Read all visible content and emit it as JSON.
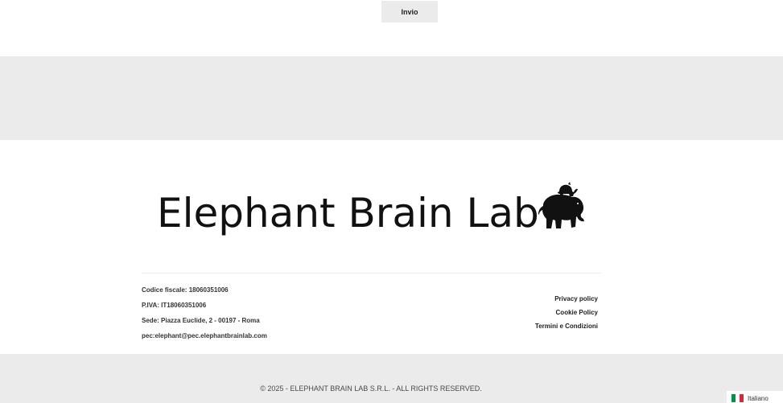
{
  "form": {
    "submit_label": "Invio"
  },
  "footer": {
    "brand": "Elephant Brain Lab",
    "company_info": [
      "Codice fiscale: 18060351006",
      "P.IVA: IT18060351006",
      "Sede: Piazza Euclide, 2 - 00197 - Roma",
      "pec:elephant@pec.elephantbrainlab.com"
    ],
    "links": [
      "Privacy policy",
      "Cookie Policy",
      "Termini e Condizioni"
    ],
    "copyright": "© 2025 - ELEPHANT BRAIN LAB S.R.L. - ALL RIGHTS RESERVED."
  },
  "language": {
    "label": "Italiano",
    "flag_colors": [
      "#009246",
      "#ffffff",
      "#ce2b37"
    ]
  },
  "colors": {
    "band_grey": "#ebebeb",
    "text_dark": "#1f1f1f"
  }
}
